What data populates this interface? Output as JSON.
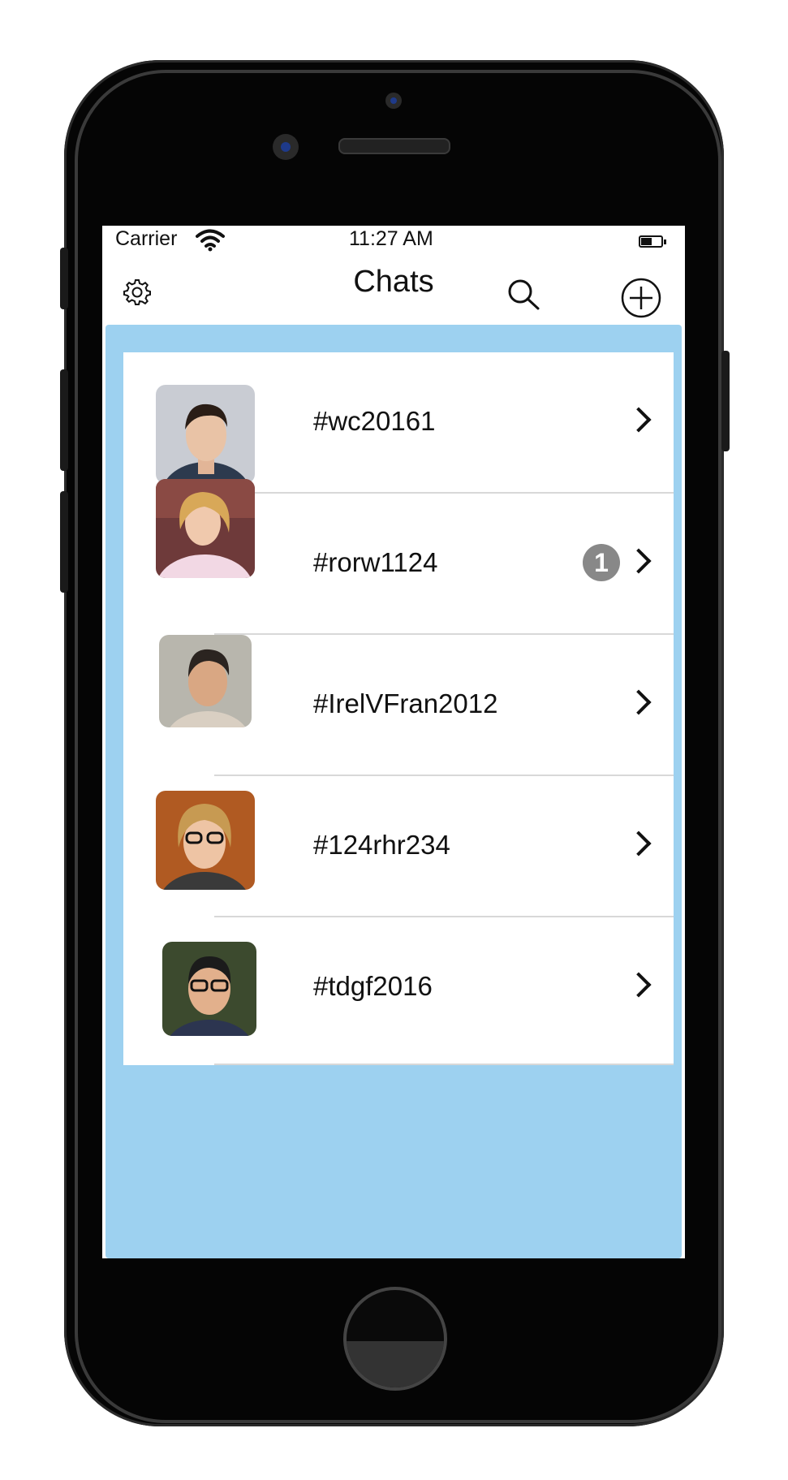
{
  "status_bar": {
    "carrier": "Carrier",
    "time": "11:27 AM"
  },
  "nav": {
    "title": "Chats",
    "icons": [
      "gear-icon",
      "search-icon",
      "add-circle-icon"
    ]
  },
  "chats": [
    {
      "name": "#wc20161",
      "badge": ""
    },
    {
      "name": "#rorw1124",
      "badge": "1"
    },
    {
      "name": "#IrelVFran2012",
      "badge": ""
    },
    {
      "name": "#124rhr234",
      "badge": ""
    },
    {
      "name": "#tdgf2016",
      "badge": ""
    }
  ],
  "colors": {
    "content_background": "#9dd1f0",
    "badge": "#888888"
  }
}
